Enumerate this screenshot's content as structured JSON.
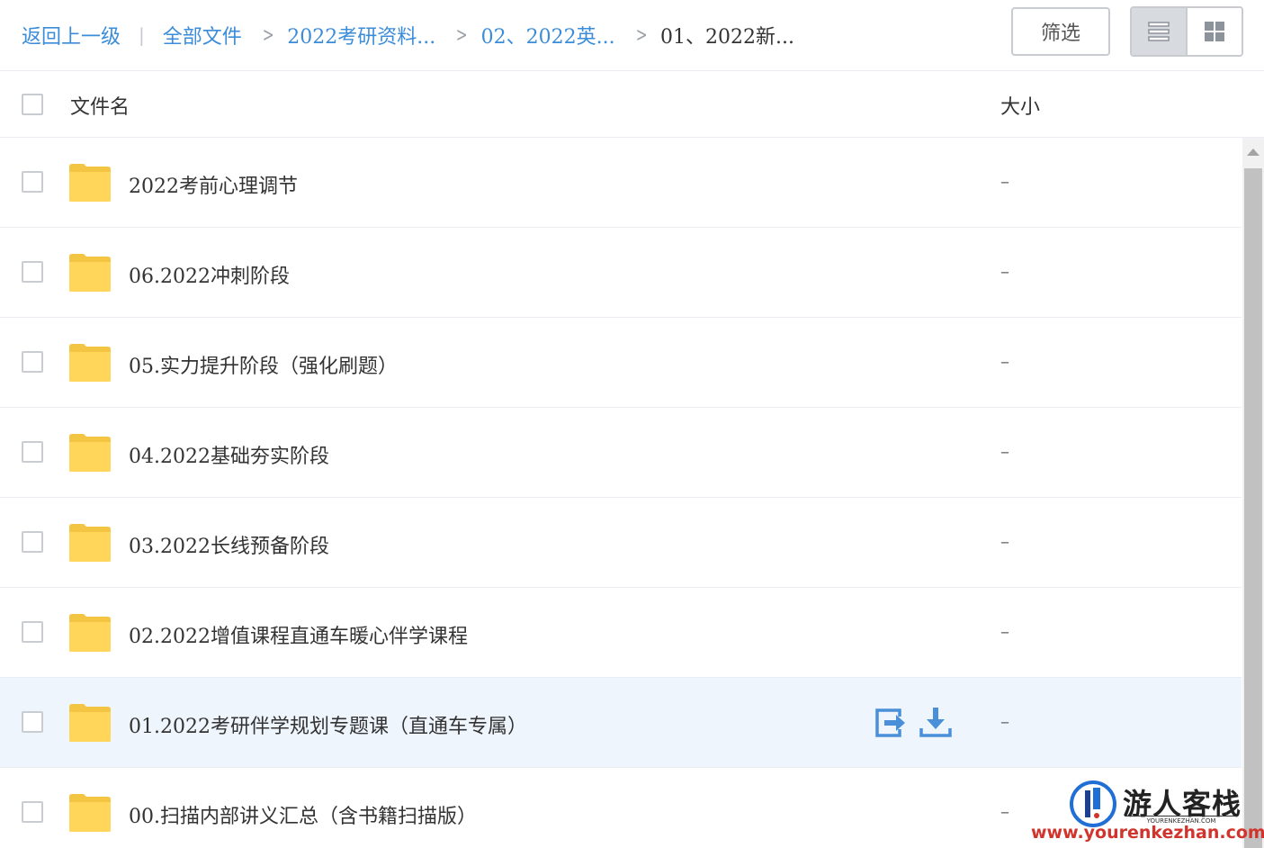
{
  "breadcrumb": {
    "back": "返回上一级",
    "all_files": "全部文件",
    "level1": "2022考研资料...",
    "level2": "02、2022英...",
    "current": "01、2022新..."
  },
  "toolbar": {
    "filter_label": "筛选",
    "view_mode": "list"
  },
  "table": {
    "col_name": "文件名",
    "col_size": "大小"
  },
  "files": [
    {
      "name": "2022考前心理调节",
      "size": "–"
    },
    {
      "name": "06.2022冲刺阶段",
      "size": "–"
    },
    {
      "name": "05.实力提升阶段（强化刷题）",
      "size": "–"
    },
    {
      "name": "04.2022基础夯实阶段",
      "size": "–"
    },
    {
      "name": "03.2022长线预备阶段",
      "size": "–"
    },
    {
      "name": "02.2022增值课程直通车暖心伴学课程",
      "size": "–"
    },
    {
      "name": "01.2022考研伴学规划专题课（直通车专属）",
      "size": "–"
    },
    {
      "name": "00.扫描内部讲义汇总（含书籍扫描版）",
      "size": "–"
    }
  ],
  "hover_row_actions": [
    "share-icon",
    "download-icon"
  ],
  "watermark": {
    "title": "游人客栈",
    "subtitle": "YOURENKEZHAN.COM",
    "url": "www.yourenkezhan.com"
  },
  "colors": {
    "link": "#3b8cd9",
    "folder": "#ffd659",
    "hover_row": "#eef5fd",
    "action_icon": "#4a90d9"
  }
}
